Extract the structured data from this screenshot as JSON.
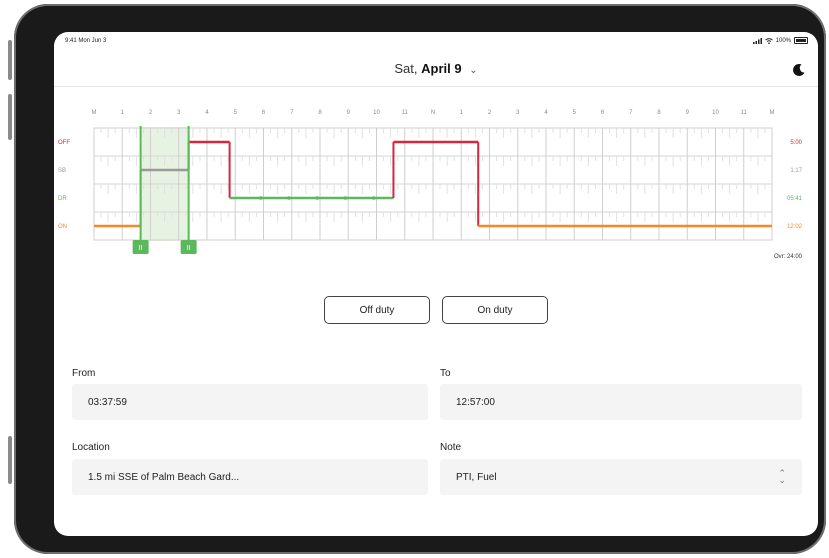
{
  "status_bar": {
    "time": "9:41 Mon Jun 3",
    "battery": "100%"
  },
  "header": {
    "date_prefix": "Sat,",
    "date_bold": "April 9"
  },
  "chart": {
    "hour_labels": [
      "M",
      "1",
      "2",
      "3",
      "4",
      "5",
      "6",
      "7",
      "8",
      "9",
      "10",
      "11",
      "N",
      "1",
      "2",
      "3",
      "4",
      "5",
      "6",
      "7",
      "8",
      "9",
      "10",
      "11",
      "M"
    ],
    "status_labels": [
      "OFF",
      "SB",
      "DR",
      "ON"
    ],
    "totals": [
      "5:00",
      "1:17",
      "05:41",
      "12:02"
    ],
    "total_overall": "Ovr: 24:00",
    "status_colors": {
      "OFF": "#d7263d",
      "SB": "#999999",
      "DR": "#5cb85c",
      "ON": "#f5882a"
    },
    "marker_label": "II",
    "segments": [
      {
        "status": "ON",
        "start": 0,
        "end": 1.65
      },
      {
        "status": "SB",
        "start": 1.65,
        "end": 3.35
      },
      {
        "status": "OFF",
        "start": 3.35,
        "end": 4.8
      },
      {
        "status": "DR",
        "start": 4.8,
        "end": 10.6
      },
      {
        "status": "OFF",
        "start": 10.6,
        "end": 13.6
      },
      {
        "status": "ON",
        "start": 13.6,
        "end": 24
      }
    ],
    "dr_dots": [
      5.9,
      6.9,
      7.9,
      8.9,
      9.9
    ],
    "selection": {
      "start": 1.65,
      "end": 3.35
    }
  },
  "buttons": {
    "off_duty": "Off duty",
    "on_duty": "On duty"
  },
  "form": {
    "from_label": "From",
    "from_value": "03:37:59",
    "to_label": "To",
    "to_value": "12:57:00",
    "location_label": "Location",
    "location_value": "1.5 mi SSE of Palm Beach Gard...",
    "note_label": "Note",
    "note_value": "PTI, Fuel"
  }
}
